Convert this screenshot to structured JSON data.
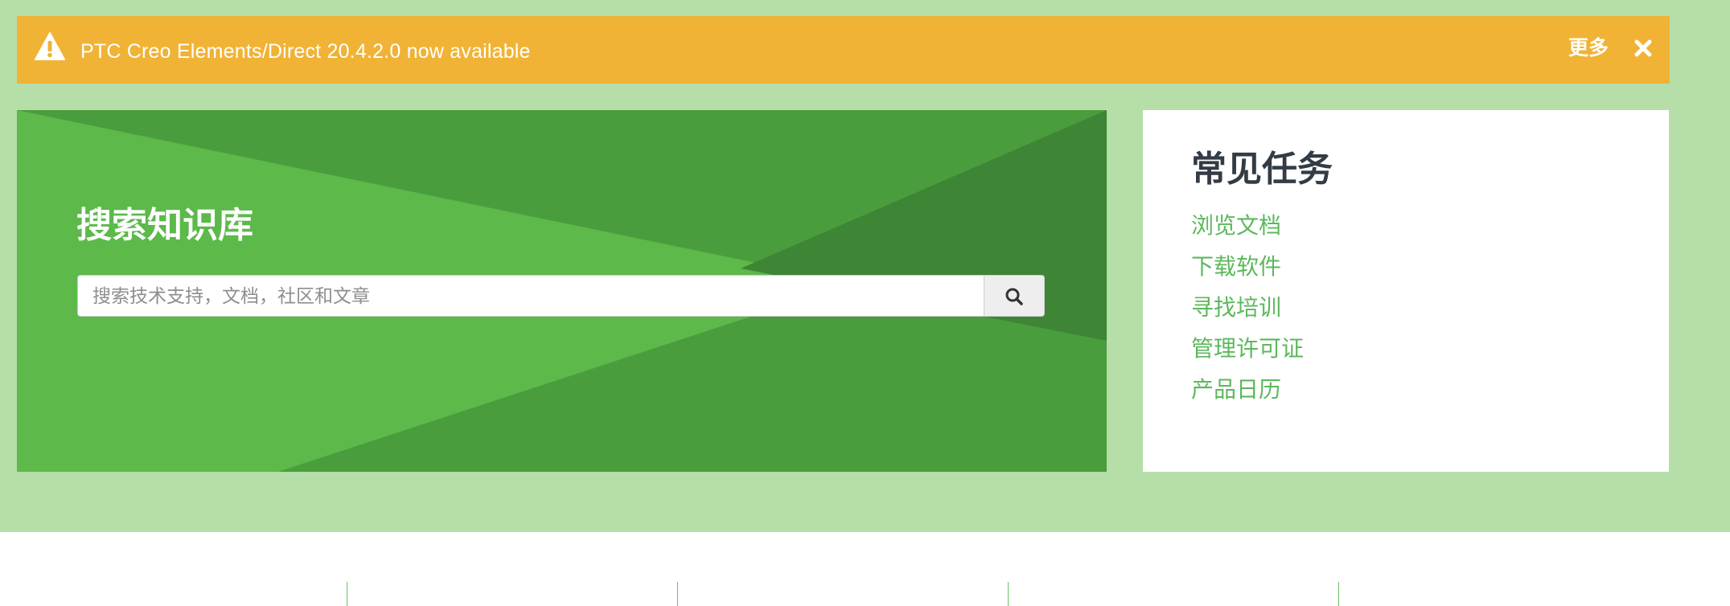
{
  "alert": {
    "message": "PTC Creo Elements/Direct 20.4.2.0 now available",
    "more_label": "更多",
    "icons": {
      "warning": "warning-triangle-icon",
      "close": "close-icon"
    }
  },
  "hero": {
    "title": "搜索知识库",
    "search": {
      "placeholder": "搜索技术支持，文档，社区和文章",
      "value": "",
      "button_icon": "search-icon"
    }
  },
  "tasks": {
    "title": "常见任务",
    "items": [
      {
        "label": "浏览文档"
      },
      {
        "label": "下载软件"
      },
      {
        "label": "寻找培训"
      },
      {
        "label": "管理许可证"
      },
      {
        "label": "产品日历"
      }
    ]
  },
  "colors": {
    "page_bg": "#b5dea8",
    "alert_bg": "#f1b335",
    "hero_green": "#4a9d3c",
    "hero_light": "#5cb94a",
    "hero_dark": "#3e8535",
    "link_green": "#5cb85c",
    "title_dark": "#333b45"
  }
}
